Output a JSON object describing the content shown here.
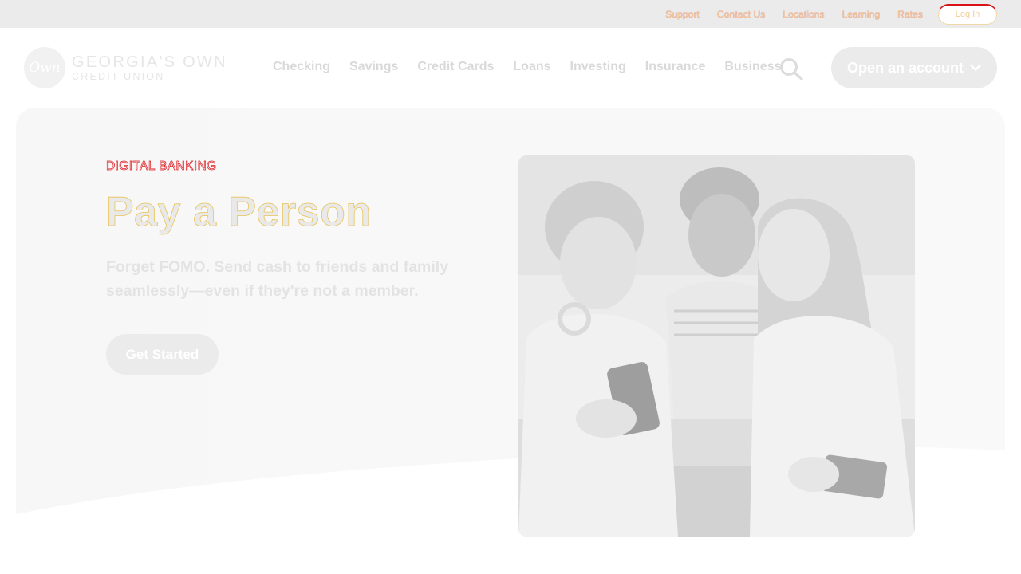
{
  "utility": {
    "links": [
      "Support",
      "Contact Us",
      "Locations",
      "Learning",
      "Rates"
    ],
    "login_label": "Log In"
  },
  "brand": {
    "mark": "Own",
    "line1": "GEORGIA'S OWN",
    "line2": "CREDIT UNION"
  },
  "nav": {
    "items": [
      "Checking",
      "Savings",
      "Credit Cards",
      "Loans",
      "Investing",
      "Insurance",
      "Business"
    ],
    "cta_label": "Open an account"
  },
  "hero": {
    "eyebrow": "DIGITAL BANKING",
    "title": "Pay a Person",
    "subtitle": "Forget FOMO. Send cash to friends and family seamlessly—even if they're not a member.",
    "cta_label": "Get Started"
  },
  "icons": {
    "search": "search-icon",
    "chevron": "chevron-down-icon"
  },
  "colors": {
    "accent_red": "#d8141a",
    "accent_gold": "#e9c45a",
    "muted_gray": "#ebebeb"
  }
}
